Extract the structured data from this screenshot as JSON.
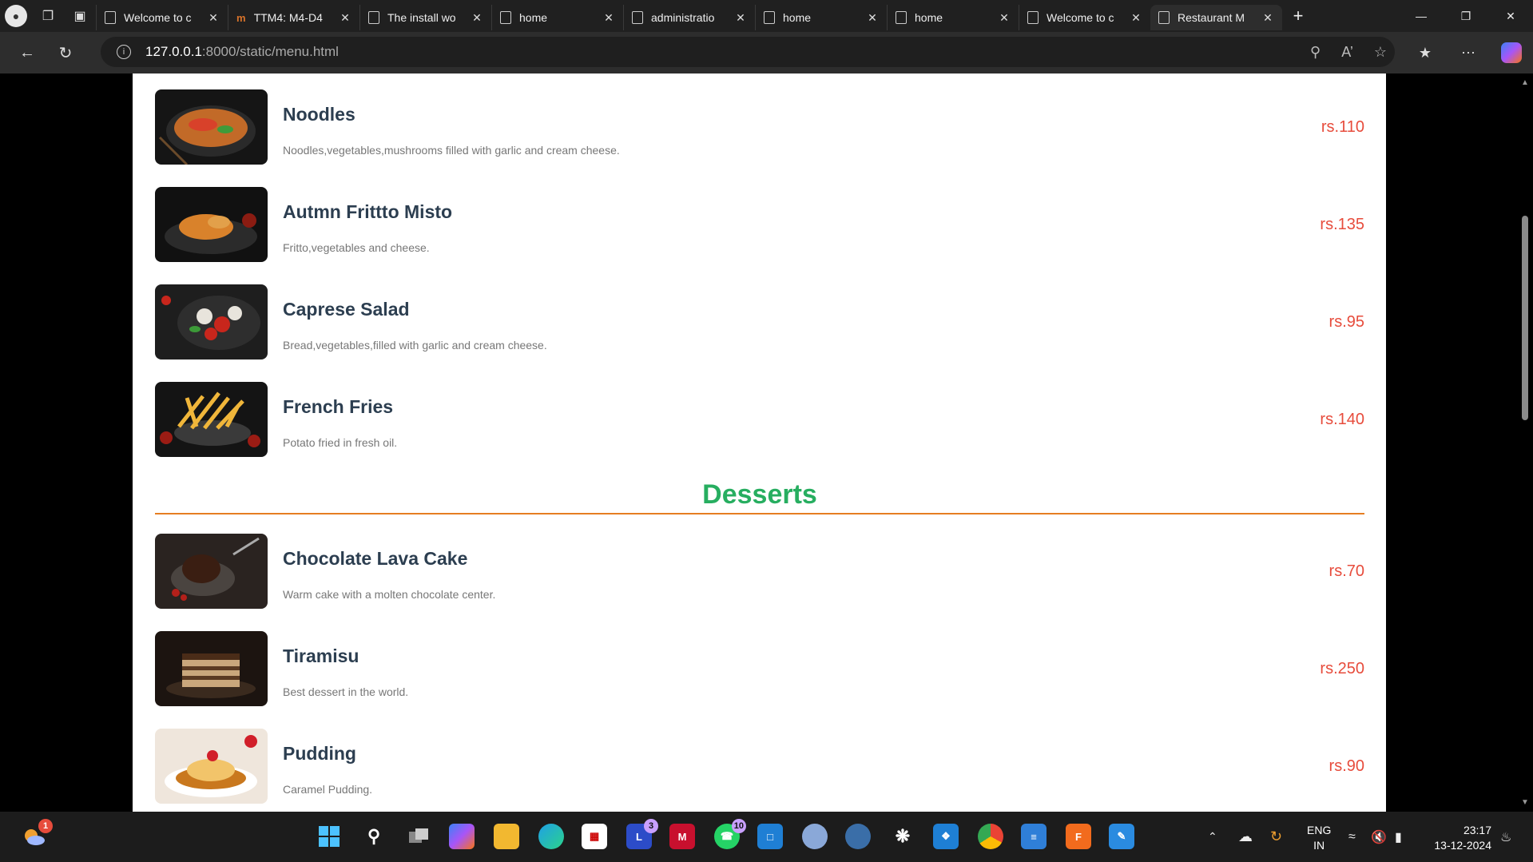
{
  "browser": {
    "tabs": [
      {
        "label": "Welcome to c",
        "active": false
      },
      {
        "label": "TTM4: M4-D4",
        "active": false
      },
      {
        "label": "The install wo",
        "active": false
      },
      {
        "label": "home",
        "active": false
      },
      {
        "label": "administratio",
        "active": false
      },
      {
        "label": "home",
        "active": false
      },
      {
        "label": "home",
        "active": false
      },
      {
        "label": "Welcome to c",
        "active": false
      },
      {
        "label": "Restaurant M",
        "active": true
      }
    ],
    "url_host": "127.0.0.1",
    "url_path": ":8000/static/menu.html"
  },
  "menu": {
    "items_top": [
      {
        "name": "Noodles",
        "description": "Noodles,vegetables,mushrooms filled with garlic and cream cheese.",
        "price": "rs.110",
        "image": "noodles-photo"
      },
      {
        "name": "Autmn Frittto Misto",
        "description": "Fritto,vegetables and cheese.",
        "price": "rs.135",
        "image": "fritto-misto-photo"
      },
      {
        "name": "Caprese Salad",
        "description": "Bread,vegetables,filled with garlic and cream cheese.",
        "price": "rs.95",
        "image": "caprese-salad-photo"
      },
      {
        "name": "French Fries",
        "description": "Potato fried in fresh oil.",
        "price": "rs.140",
        "image": "french-fries-photo"
      }
    ],
    "desserts_title": "Desserts",
    "desserts": [
      {
        "name": "Chocolate Lava Cake",
        "description": "Warm cake with a molten chocolate center.",
        "price": "rs.70",
        "image": "lava-cake-photo"
      },
      {
        "name": "Tiramisu",
        "description": "Best dessert in the world.",
        "price": "rs.250",
        "image": "tiramisu-photo"
      },
      {
        "name": "Pudding",
        "description": "Caramel Pudding.",
        "price": "rs.90",
        "image": "pudding-photo"
      }
    ]
  },
  "taskbar": {
    "weather_badge": "1",
    "teams_badge": "3",
    "whatsapp_badge": "10",
    "lang_top": "ENG",
    "lang_bottom": "IN",
    "time": "23:17",
    "date": "13-12-2024"
  },
  "colors": {
    "item_name": "#2c3e50",
    "price": "#e74c3c",
    "section_title": "#27ae60",
    "section_line": "#e67e22"
  }
}
